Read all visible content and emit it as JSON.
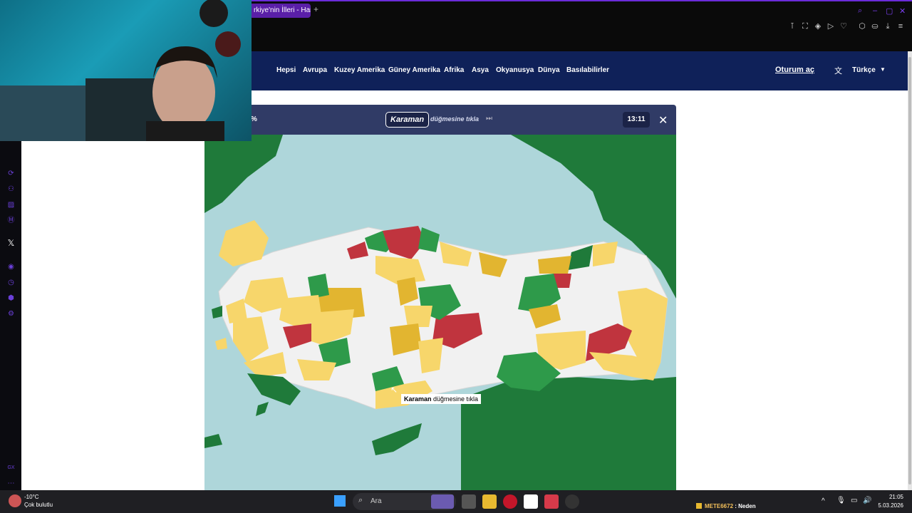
{
  "browser": {
    "tab_title": "rkiye'nin İlleri - Harit",
    "new_tab": "+"
  },
  "site_nav": {
    "items": [
      "Hepsi",
      "Avrupa",
      "Kuzey Amerika",
      "Güney Amerika",
      "Afrika",
      "Asya",
      "Okyanusya",
      "Dünya",
      "Basılabilirler"
    ],
    "login": "Oturum aç",
    "language": "Türkçe"
  },
  "quiz": {
    "percent": "%",
    "target": "Karaman",
    "prompt": "düğmesine tıkla",
    "timer": "13:11",
    "tooltip_target": "Karaman",
    "tooltip_text": " düğmesine tıkla"
  },
  "map_colors": {
    "sea": "#aed6da",
    "land_neighbor": "#1f7a3a",
    "correct_first": "#2e9a4a",
    "correct_second": "#f7d66b",
    "correct_third": "#e2b530",
    "wrong": "#c0343e",
    "unanswered": "#f1f1f1"
  },
  "taskbar": {
    "weather_temp": "-10°C",
    "weather_cond": "Çok bulutlu",
    "search": "Ara",
    "notification_user": "METE6672",
    "notification_text": "Neden",
    "time": "21:05",
    "date": "5.03.2026"
  }
}
